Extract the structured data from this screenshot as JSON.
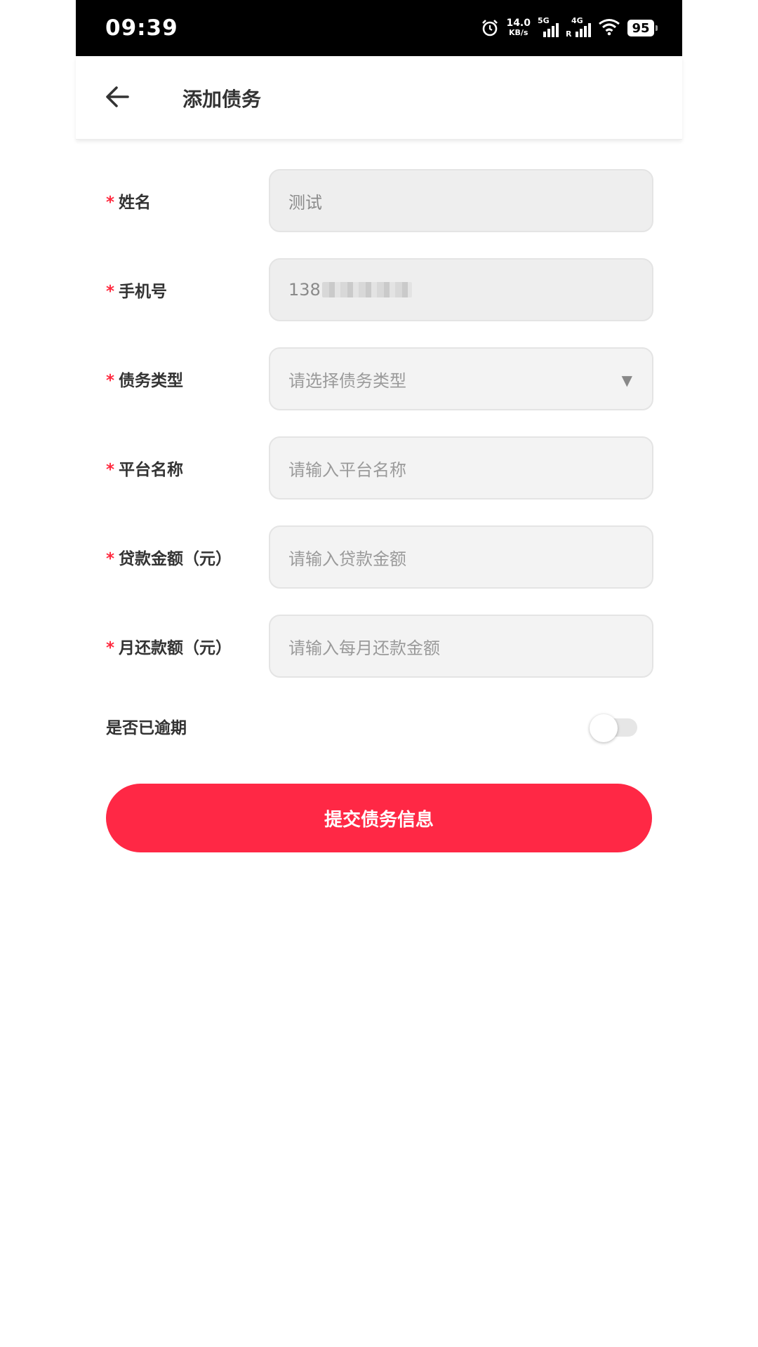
{
  "status_bar": {
    "time": "09:39",
    "net_speed_value": "14.0",
    "net_speed_unit": "KB/s",
    "sim1_type": "5G",
    "sim2_type": "4G",
    "roaming": "R",
    "battery": "95",
    "icons": [
      "alarm-icon",
      "signal-icon",
      "wifi-icon",
      "battery-icon"
    ]
  },
  "header": {
    "title": "添加债务",
    "back_icon": "arrow-left-icon"
  },
  "form": {
    "name": {
      "required_mark": "*",
      "label": "姓名",
      "value": "测试"
    },
    "phone": {
      "required_mark": "*",
      "label": "手机号",
      "value": "138"
    },
    "debt_type": {
      "required_mark": "*",
      "label": "债务类型",
      "placeholder": "请选择债务类型",
      "arrow": "▼"
    },
    "platform": {
      "required_mark": "*",
      "label": "平台名称",
      "placeholder": "请输入平台名称"
    },
    "loan_amount": {
      "required_mark": "*",
      "label": "贷款金额（元）",
      "placeholder": "请输入贷款金额"
    },
    "monthly_repayment": {
      "required_mark": "*",
      "label": "月还款额（元）",
      "placeholder": "请输入每月还款金额"
    },
    "overdue": {
      "label": "是否已逾期",
      "checked": false
    }
  },
  "submit": {
    "label": "提交债务信息",
    "color": "#ff2845"
  },
  "colors": {
    "accent": "#ff2845",
    "required": "#ff2a3f"
  }
}
